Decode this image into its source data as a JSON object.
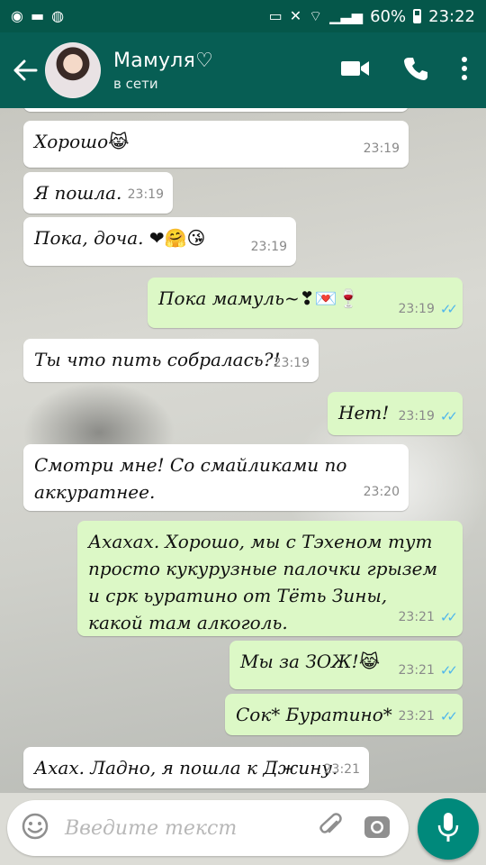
{
  "status_bar": {
    "battery": "60%",
    "time": "23:22"
  },
  "header": {
    "name": "Мамуля♡",
    "status": "в сети"
  },
  "messages": [
    {
      "dir": "in",
      "text": "Хорошо",
      "emoji": "😹",
      "time": "23:19"
    },
    {
      "dir": "in",
      "text": "Я пошла.",
      "emoji": "",
      "time": "23:19"
    },
    {
      "dir": "in",
      "text": "Пока, доча.",
      "emoji": "❤🤗😘",
      "time": "23:19"
    },
    {
      "dir": "out",
      "text": "Пока мамуль~",
      "emoji": "❣💌🍷",
      "time": "23:19"
    },
    {
      "dir": "in",
      "text": "Ты что пить собралась?!",
      "emoji": "",
      "time": "23:19"
    },
    {
      "dir": "out",
      "text": "Нет!",
      "emoji": "",
      "time": "23:19"
    },
    {
      "dir": "in",
      "text": "Смотри мне! Со смайликами по аккуратнее.",
      "emoji": "",
      "time": "23:20"
    },
    {
      "dir": "out",
      "text": "Ахахах. Хорошо, мы с Тэхеном тут просто кукурузные палочки грызем и срк ьуратино от Тёть Зины, какой там алкоголь.",
      "emoji": "",
      "time": "23:21"
    },
    {
      "dir": "out",
      "text": "Мы за ЗОЖ!",
      "emoji": "😹",
      "time": "23:21"
    },
    {
      "dir": "out",
      "text": "Сок* Буратино*",
      "emoji": "",
      "time": "23:21"
    },
    {
      "dir": "in",
      "text": "Ахах. Ладно, я пошла к Джину.",
      "emoji": "",
      "time": "23:21"
    }
  ],
  "composer": {
    "placeholder": "Введите текст"
  },
  "colors": {
    "header": "#075e54",
    "statusbar": "#05574a",
    "outgoing": "#dcf8c6",
    "incoming": "#ffffff",
    "read_ticks": "#4fb6ec",
    "mic_button": "#00897b"
  }
}
